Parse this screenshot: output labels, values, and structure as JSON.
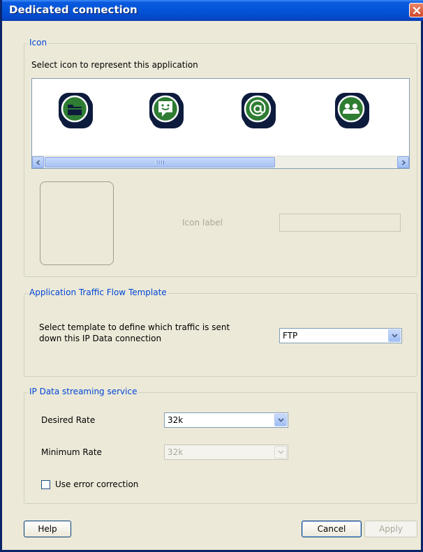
{
  "window": {
    "title": "Dedicated connection"
  },
  "icon_group": {
    "legend": "Icon",
    "instruction": "Select icon to represent this application",
    "icons": [
      "folder-app-icon",
      "chat-app-icon",
      "email-app-icon",
      "contacts-app-icon"
    ],
    "icon_label": "Icon label",
    "icon_label_value": ""
  },
  "traffic_group": {
    "legend": "Application Traffic Flow Template",
    "instruction_line1": "Select template to define which traffic is sent",
    "instruction_line2": "down this IP Data connection",
    "template_value": "FTP"
  },
  "streaming_group": {
    "legend": "IP Data streaming service",
    "desired_rate_label": "Desired Rate",
    "desired_rate_value": "32k",
    "minimum_rate_label": "Minimum Rate",
    "minimum_rate_value": "32k",
    "error_correction_label": "Use error correction",
    "error_correction_checked": false
  },
  "buttons": {
    "help": "Help",
    "cancel": "Cancel",
    "apply": "Apply"
  },
  "colors": {
    "titlebar": "#0454d8",
    "legend_text": "#0046d5",
    "icon_green": "#2e7d32",
    "icon_navy": "#0d1b3d",
    "background": "#ece9d8"
  }
}
